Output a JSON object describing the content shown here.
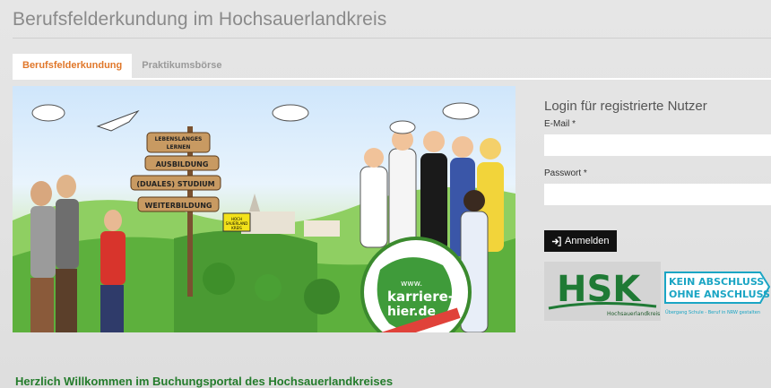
{
  "site": {
    "title": "Berufsfelderkundung im Hochsauerlandkreis"
  },
  "tabs": [
    {
      "label": "Berufsfelderkundung",
      "active": true
    },
    {
      "label": "Praktikumsbörse",
      "active": false
    }
  ],
  "hero": {
    "signs": [
      "LEBENSLANGES LERNEN",
      "AUSBILDUNG",
      "(DUALES) STUDIUM",
      "WEITERBILDUNG"
    ],
    "globe_url_lines": [
      "www.",
      "karriere-",
      "hier.de"
    ],
    "globe_banner": [
      "DIE KARRIERESEITE",
      "FÜR SIE UND HIER."
    ],
    "mini_sign": [
      "HOCH",
      "SAUERLAND",
      "KREIS"
    ]
  },
  "login": {
    "heading": "Login für registrierte Nutzer",
    "email_label": "E-Mail *",
    "email_value": "",
    "password_label": "Passwort *",
    "password_value": "",
    "button_label": "Anmelden",
    "button_icon": "sign-in-icon"
  },
  "logos": {
    "hsk": {
      "text": "HSK",
      "subtext": "Hochsauerlandkreis"
    },
    "kaoa": {
      "line1": "KEIN ABSCHLUSS",
      "line2": "OHNE ANSCHLUSS",
      "tagline": "Übergang Schule - Beruf in NRW gestalten"
    }
  },
  "main": {
    "welcome": "Herzlich Willkommen im Buchungsportal des Hochsauerlandkreises"
  },
  "colors": {
    "accent": "#e0772a",
    "welcome": "#247c2c",
    "button": "#111111"
  }
}
